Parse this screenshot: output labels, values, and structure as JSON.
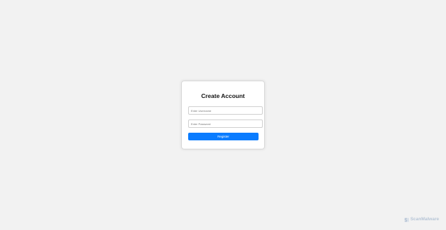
{
  "form": {
    "title": "Create Account",
    "username_placeholder": "Enter Username",
    "password_placeholder": "Enter Password",
    "submit_label": "Register"
  },
  "watermark": {
    "text": "ScanMalware",
    "icon": "scanmalware-logo-icon"
  },
  "colors": {
    "background": "#f2f2f2",
    "card": "#ffffff",
    "button": "#0a7cff",
    "button_text": "#ffffff"
  }
}
